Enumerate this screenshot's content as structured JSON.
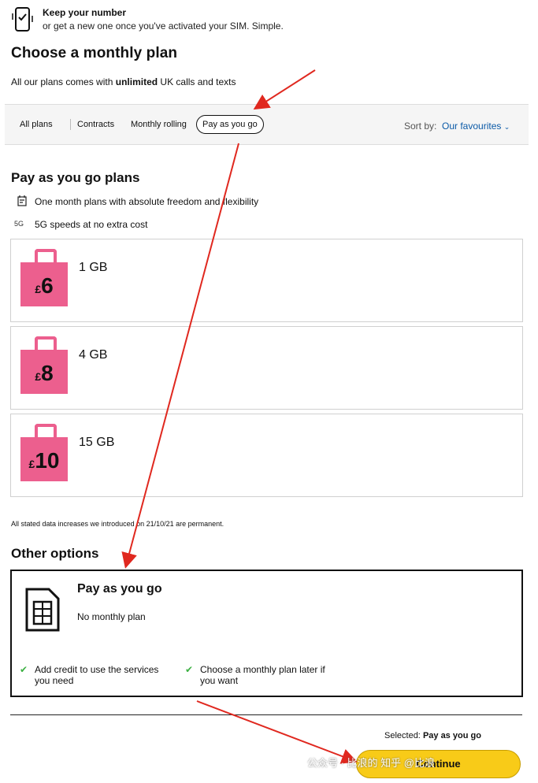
{
  "header": {
    "keep_title": "Keep your number",
    "keep_sub": "or get a new one once you've activated your SIM. Simple."
  },
  "page_title": "Choose a monthly plan",
  "intro": {
    "prefix": "All our plans comes with ",
    "bold": "unlimited",
    "suffix": " UK calls and texts"
  },
  "filters": {
    "items": [
      "All plans",
      "Contracts",
      "Monthly rolling",
      "Pay as you go"
    ],
    "selected": "Pay as you go",
    "sort_label": "Sort by:",
    "sort_value": "Our favourites"
  },
  "payg": {
    "title": "Pay as you go plans",
    "features": [
      {
        "icon": "calendar-icon",
        "text": "One month plans with absolute freedom and flexibility"
      },
      {
        "icon": "5g-icon",
        "icon_text": "5G",
        "text": "5G speeds at no extra cost"
      }
    ],
    "plans": [
      {
        "currency": "£",
        "price": "6",
        "data": "1 GB"
      },
      {
        "currency": "£",
        "price": "8",
        "data": "4 GB"
      },
      {
        "currency": "£",
        "price": "10",
        "data": "15 GB"
      }
    ],
    "note": "All stated data increases we introduced on 21/10/21 are permanent."
  },
  "other": {
    "title": "Other options",
    "card_title": "Pay as you go",
    "card_sub": "No monthly plan",
    "bullets": [
      "Add credit to use the services you need",
      "Choose a monthly plan later if you want"
    ]
  },
  "footer": {
    "selected_label": "Selected:",
    "selected_value": "Pay as you go",
    "continue": "Continue",
    "watermark": "公众号 · 比浪的  知乎 @比浪"
  },
  "colors": {
    "accent_pink": "#ec5f8e",
    "continue_yellow": "#f8cb18",
    "link_blue": "#0b5aa7",
    "arrow_red": "#e0281f"
  }
}
